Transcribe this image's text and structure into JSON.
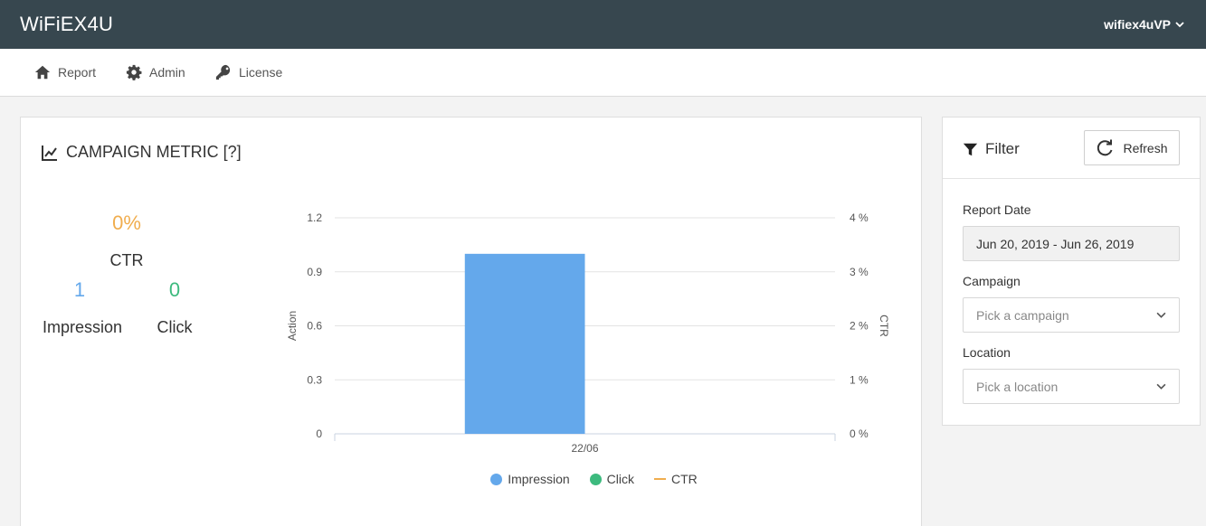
{
  "app": {
    "brand": "WiFiEX4U",
    "user": "wifiex4uVP"
  },
  "nav": [
    {
      "label": "Report",
      "icon": "home-icon"
    },
    {
      "label": "Admin",
      "icon": "gear-icon"
    },
    {
      "label": "License",
      "icon": "key-icon"
    }
  ],
  "metric": {
    "title": "CAMPAIGN METRIC [?]",
    "ctr_value": "0%",
    "ctr_label": "CTR",
    "impression_value": "1",
    "impression_label": "Impression",
    "click_value": "0",
    "click_label": "Click"
  },
  "filter": {
    "title": "Filter",
    "refresh_label": "Refresh",
    "report_date_label": "Report Date",
    "report_date_value": "Jun 20, 2019 - Jun 26, 2019",
    "campaign_label": "Campaign",
    "campaign_placeholder": "Pick a campaign",
    "location_label": "Location",
    "location_placeholder": "Pick a location"
  },
  "colors": {
    "impression": "#64a8eb",
    "click": "#3dba7e",
    "ctr": "#f0ad4e",
    "topbar": "#37474f"
  },
  "chart_data": {
    "type": "bar",
    "categories": [
      "22/06"
    ],
    "series": [
      {
        "name": "Impression",
        "values": [
          1
        ],
        "axis": "left"
      },
      {
        "name": "Click",
        "values": [
          0
        ],
        "axis": "left"
      },
      {
        "name": "CTR",
        "values": [
          0
        ],
        "axis": "right",
        "kind": "line"
      }
    ],
    "ylabel": "Action",
    "y2label": "CTR",
    "ylim": [
      0,
      1.2
    ],
    "y2lim": [
      0,
      4
    ],
    "yticks": [
      "0",
      "0.3",
      "0.6",
      "0.9",
      "1.2"
    ],
    "y2ticks": [
      "0 %",
      "1 %",
      "2 %",
      "3 %",
      "4 %"
    ],
    "legend_position": "bottom",
    "grid": true
  }
}
